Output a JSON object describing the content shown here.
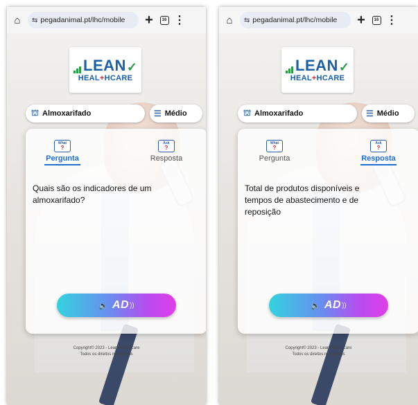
{
  "screens": [
    {
      "browser": {
        "url": "pegadanimal.pt/lhc/mobile",
        "tab_count": "16"
      },
      "logo": {
        "top": "LEAN",
        "bottom_left": "HEAL",
        "bottom_cross": "+",
        "bottom_right": "HCARE"
      },
      "category": "Almoxarifado",
      "level": "Médio",
      "tabs": {
        "question": "Pergunta",
        "answer": "Resposta",
        "active": "question"
      },
      "text": "Quais são os indicadores de um almoxarifado?",
      "audio_label": "AD",
      "copyright_line1": "Copyright© 2023 - Lean HealthCare",
      "copyright_line2": "Todos os direitos reservados"
    },
    {
      "browser": {
        "url": "pegadanimal.pt/lhc/mobile",
        "tab_count": "16"
      },
      "logo": {
        "top": "LEAN",
        "bottom_left": "HEAL",
        "bottom_cross": "+",
        "bottom_right": "HCARE"
      },
      "category": "Almoxarifado",
      "level": "Médio",
      "tabs": {
        "question": "Pergunta",
        "answer": "Resposta",
        "active": "answer"
      },
      "text": "Total de produtos disponíveis e tempos de abastecimento e de reposição",
      "audio_label": "AD",
      "copyright_line1": "Copyright© 2023 - Lean HealthCare",
      "copyright_line2": "Todos os direitos reservados"
    }
  ],
  "badge_top": "What",
  "badge_top_answer": "Ask",
  "badge_mark": "?",
  "colors": {
    "accent": "#1d6fd1",
    "logo_blue": "#1b5fa8",
    "logo_green": "#2d9c4a",
    "logo_red": "#d6232a"
  }
}
